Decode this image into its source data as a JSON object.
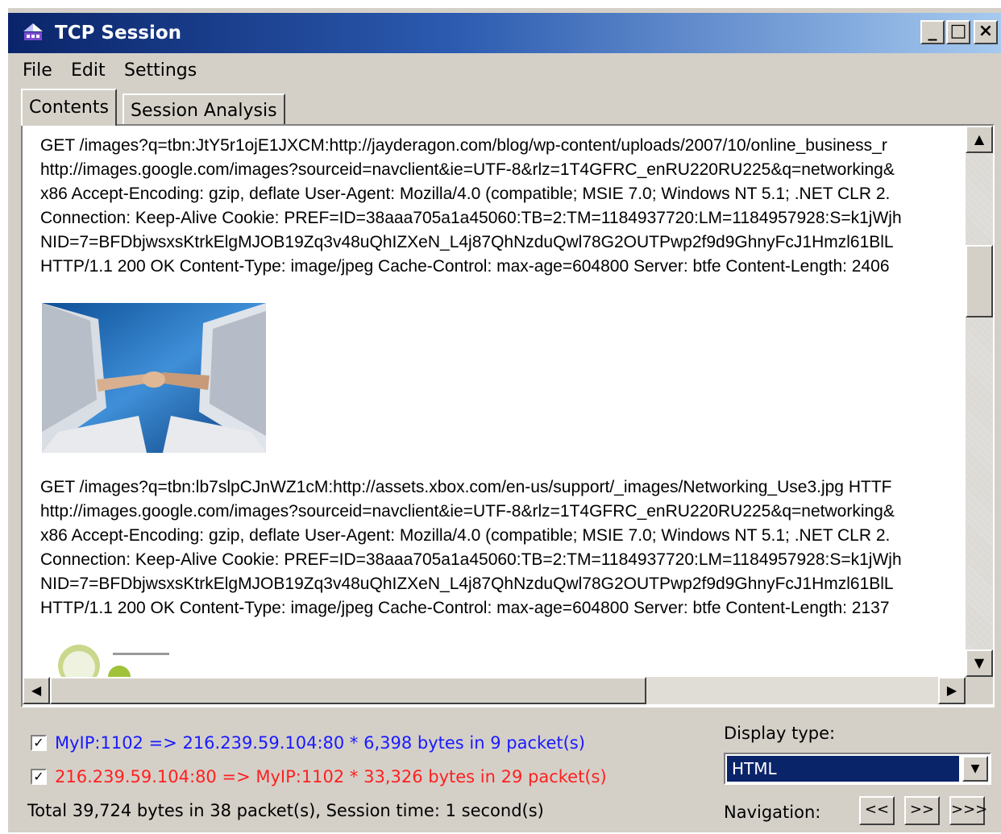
{
  "window": {
    "title": "TCP Session",
    "min_glyph": "_",
    "max_glyph": "□",
    "close_glyph": "×"
  },
  "menu": {
    "file": "File",
    "edit": "Edit",
    "settings": "Settings"
  },
  "tabs": {
    "contents": "Contents",
    "session_analysis": "Session Analysis"
  },
  "content": {
    "request1": [
      "GET /images?q=tbn:JtY5r1ojE1JXCM:http://jayderagon.com/blog/wp-content/uploads/2007/10/online_business_r",
      "http://images.google.com/images?sourceid=navclient&ie=UTF-8&rlz=1T4GFRC_enRU220RU225&q=networking&",
      "x86 Accept-Encoding: gzip, deflate User-Agent: Mozilla/4.0 (compatible; MSIE 7.0; Windows NT 5.1; .NET CLR 2.",
      "Connection: Keep-Alive Cookie: PREF=ID=38aaa705a1a45060:TB=2:TM=1184937720:LM=1184957928:S=k1jWjh",
      "NID=7=BFDbjwsxsKtrkElgMJOB19Zq3v48uQhIZXeN_L4j87QhNzduQwl78G2OUTPwp2f9d9GhnyFcJ1Hmzl61BlL",
      "HTTP/1.1 200 OK Content-Type: image/jpeg Cache-Control: max-age=604800 Server: btfe Content-Length: 2406"
    ],
    "request2": [
      "GET /images?q=tbn:lb7slpCJnWZ1cM:http://assets.xbox.com/en-us/support/_images/Networking_Use3.jpg HTTF",
      "http://images.google.com/images?sourceid=navclient&ie=UTF-8&rlz=1T4GFRC_enRU220RU225&q=networking&",
      "x86 Accept-Encoding: gzip, deflate User-Agent: Mozilla/4.0 (compatible; MSIE 7.0; Windows NT 5.1; .NET CLR 2.",
      "Connection: Keep-Alive Cookie: PREF=ID=38aaa705a1a45060:TB=2:TM=1184937720:LM=1184957928:S=k1jWjh",
      "NID=7=BFDbjwsxsKtrkElgMJOB19Zq3v48uQhIZXeN_L4j87QhNzduQwl78G2OUTPwp2f9d9GhnyFcJ1Hmzl61BlL",
      "HTTP/1.1 200 OK Content-Type: image/jpeg Cache-Control: max-age=604800 Server: btfe Content-Length: 2137"
    ]
  },
  "streams": [
    {
      "label": "MyIP:1102 => 216.239.59.104:80 * 6,398 bytes in 9 packet(s)",
      "color": "#1a1aff",
      "checked": true
    },
    {
      "label": "216.239.59.104:80 => MyIP:1102 * 33,326 bytes in 29 packet(s)",
      "color": "#ff2020",
      "checked": true
    }
  ],
  "summary": "Total 39,724 bytes in 38 packet(s), Session time: 1 second(s)",
  "display_type": {
    "label": "Display type:",
    "value": "HTML"
  },
  "navigation": {
    "label": "Navigation:",
    "buttons": [
      "<<",
      ">>",
      ">>>"
    ]
  },
  "scroll": {
    "up": "▲",
    "down": "▼",
    "left": "◀",
    "right": "▶",
    "checkmark": "✓",
    "dropdown": "▼"
  }
}
